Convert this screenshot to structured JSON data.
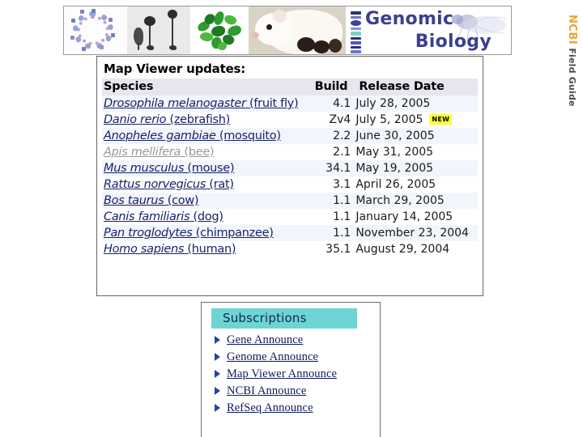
{
  "banner": {
    "images": [
      {
        "name": "circular-genome-map-image",
        "alt": "circular genome map"
      },
      {
        "name": "dictyostelium-image",
        "alt": "dictyostelium stalks"
      },
      {
        "name": "arabidopsis-plant-image",
        "alt": "arabidopsis plant"
      },
      {
        "name": "rat-image",
        "alt": "white rat with pups"
      }
    ],
    "logo_line1": "Genomic",
    "logo_line2": "Biology",
    "logo_color": "#3b3f8f",
    "ideogram_icon": "chromosome-ideogram-icon",
    "fly_icon": "fruit-fly-image"
  },
  "sidetab": {
    "brand": "NCBI",
    "subtitle": "Field Guide",
    "brand_color": "#e8a33d",
    "subtitle_color": "#4d4d4d"
  },
  "map_viewer": {
    "title": "Map Viewer updates:",
    "columns": [
      "Species",
      "Build",
      "Release Date"
    ],
    "header_bg": "#e6e6ef",
    "rows": [
      {
        "genus": "Drosophila melanogaster",
        "common": " (fruit fly)",
        "build": "4.1",
        "date": "July 28, 2005",
        "new": false,
        "visited": false
      },
      {
        "genus": "Danio rerio",
        "common": " (zebrafish)",
        "build": "Zv4",
        "date": "July 5, 2005",
        "new": true,
        "visited": false
      },
      {
        "genus": "Anopheles gambiae",
        "common": " (mosquito)",
        "build": "2.2",
        "date": "June 30, 2005",
        "new": false,
        "visited": false
      },
      {
        "genus": "Apis mellifera",
        "common": " (bee)",
        "build": "2.1",
        "date": "May 31, 2005",
        "new": false,
        "visited": true
      },
      {
        "genus": "Mus musculus",
        "common": " (mouse)",
        "build": "34.1",
        "date": "May 19, 2005",
        "new": false,
        "visited": false
      },
      {
        "genus": "Rattus norvegicus",
        "common": " (rat)",
        "build": "3.1",
        "date": "April 26, 2005",
        "new": false,
        "visited": false
      },
      {
        "genus": "Bos taurus",
        "common": " (cow)",
        "build": "1.1",
        "date": "March 29, 2005",
        "new": false,
        "visited": false
      },
      {
        "genus": "Canis familiaris",
        "common": " (dog)",
        "build": "1.1",
        "date": "January 14, 2005",
        "new": false,
        "visited": false
      },
      {
        "genus": "Pan troglodytes",
        "common": " (chimpanzee)",
        "build": "1.1",
        "date": "November 23, 2004",
        "new": false,
        "visited": false
      },
      {
        "genus": "Homo sapiens",
        "common": " (human)",
        "build": "35.1",
        "date": "August 29, 2004",
        "new": false,
        "visited": false
      }
    ],
    "new_badge_label": "NEW",
    "new_badge_color": "#ffff33"
  },
  "subscriptions": {
    "header": "Subscriptions",
    "header_bg": "#6fd4d4",
    "bullet_icon": "triangle-right-icon",
    "items": [
      {
        "label": "Gene Announce"
      },
      {
        "label": "Genome Announce"
      },
      {
        "label": "Map Viewer Announce"
      },
      {
        "label": "NCBI Announce"
      },
      {
        "label": "RefSeq Announce"
      }
    ]
  }
}
